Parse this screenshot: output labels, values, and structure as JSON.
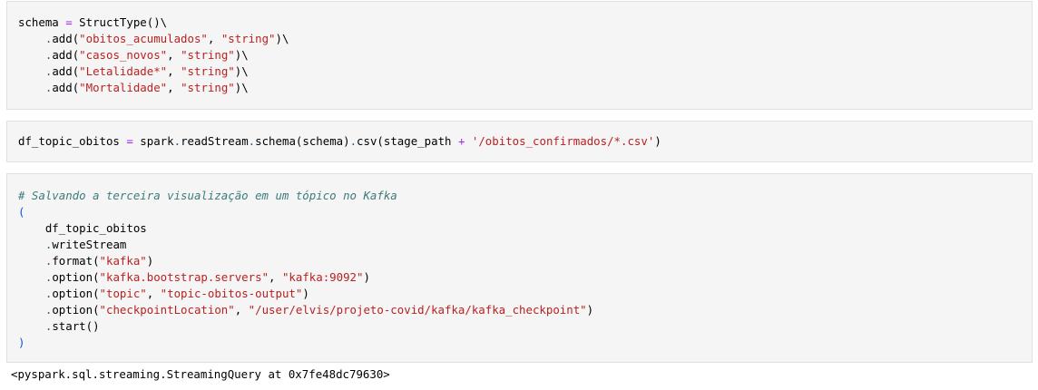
{
  "cells": [
    {
      "lines": [
        [
          {
            "t": "schema ",
            "c": ""
          },
          {
            "t": "=",
            "c": "op"
          },
          {
            "t": " StructType()\\",
            "c": ""
          }
        ],
        [
          {
            "t": "    ",
            "c": ""
          },
          {
            "t": ".",
            "c": "dot"
          },
          {
            "t": "add(",
            "c": ""
          },
          {
            "t": "\"obitos_acumulados\"",
            "c": "str"
          },
          {
            "t": ", ",
            "c": ""
          },
          {
            "t": "\"string\"",
            "c": "str"
          },
          {
            "t": ")\\",
            "c": ""
          }
        ],
        [
          {
            "t": "    ",
            "c": ""
          },
          {
            "t": ".",
            "c": "dot"
          },
          {
            "t": "add(",
            "c": ""
          },
          {
            "t": "\"casos_novos\"",
            "c": "str"
          },
          {
            "t": ", ",
            "c": ""
          },
          {
            "t": "\"string\"",
            "c": "str"
          },
          {
            "t": ")\\",
            "c": ""
          }
        ],
        [
          {
            "t": "    ",
            "c": ""
          },
          {
            "t": ".",
            "c": "dot"
          },
          {
            "t": "add(",
            "c": ""
          },
          {
            "t": "\"Letalidade*\"",
            "c": "str"
          },
          {
            "t": ", ",
            "c": ""
          },
          {
            "t": "\"string\"",
            "c": "str"
          },
          {
            "t": ")\\",
            "c": ""
          }
        ],
        [
          {
            "t": "    ",
            "c": ""
          },
          {
            "t": ".",
            "c": "dot"
          },
          {
            "t": "add(",
            "c": ""
          },
          {
            "t": "\"Mortalidade\"",
            "c": "str"
          },
          {
            "t": ", ",
            "c": ""
          },
          {
            "t": "\"string\"",
            "c": "str"
          },
          {
            "t": ")\\",
            "c": ""
          }
        ]
      ]
    },
    {
      "lines": [
        [
          {
            "t": "df_topic_obitos ",
            "c": ""
          },
          {
            "t": "=",
            "c": "op"
          },
          {
            "t": " spark",
            "c": ""
          },
          {
            "t": ".",
            "c": "dot"
          },
          {
            "t": "readStream",
            "c": ""
          },
          {
            "t": ".",
            "c": "dot"
          },
          {
            "t": "schema(schema)",
            "c": ""
          },
          {
            "t": ".",
            "c": "dot"
          },
          {
            "t": "csv(stage_path ",
            "c": ""
          },
          {
            "t": "+",
            "c": "op"
          },
          {
            "t": " ",
            "c": ""
          },
          {
            "t": "'/obitos_confirmados/*.csv'",
            "c": "str"
          },
          {
            "t": ")",
            "c": ""
          }
        ]
      ]
    },
    {
      "lines": [
        [
          {
            "t": "# Salvando a terceira visualização em um tópico no Kafka",
            "c": "cmt"
          }
        ],
        [
          {
            "t": "(",
            "c": "punc"
          }
        ],
        [
          {
            "t": "    df_topic_obitos",
            "c": ""
          }
        ],
        [
          {
            "t": "    ",
            "c": ""
          },
          {
            "t": ".",
            "c": "dot"
          },
          {
            "t": "writeStream",
            "c": ""
          }
        ],
        [
          {
            "t": "    ",
            "c": ""
          },
          {
            "t": ".",
            "c": "dot"
          },
          {
            "t": "format(",
            "c": ""
          },
          {
            "t": "\"kafka\"",
            "c": "str"
          },
          {
            "t": ")",
            "c": ""
          }
        ],
        [
          {
            "t": "    ",
            "c": ""
          },
          {
            "t": ".",
            "c": "dot"
          },
          {
            "t": "option(",
            "c": ""
          },
          {
            "t": "\"kafka.bootstrap.servers\"",
            "c": "str"
          },
          {
            "t": ", ",
            "c": ""
          },
          {
            "t": "\"kafka:9092\"",
            "c": "str"
          },
          {
            "t": ")",
            "c": ""
          }
        ],
        [
          {
            "t": "    ",
            "c": ""
          },
          {
            "t": ".",
            "c": "dot"
          },
          {
            "t": "option(",
            "c": ""
          },
          {
            "t": "\"topic\"",
            "c": "str"
          },
          {
            "t": ", ",
            "c": ""
          },
          {
            "t": "\"topic-obitos-output\"",
            "c": "str"
          },
          {
            "t": ")",
            "c": ""
          }
        ],
        [
          {
            "t": "    ",
            "c": ""
          },
          {
            "t": ".",
            "c": "dot"
          },
          {
            "t": "option(",
            "c": ""
          },
          {
            "t": "\"checkpointLocation\"",
            "c": "str"
          },
          {
            "t": ", ",
            "c": ""
          },
          {
            "t": "\"/user/elvis/projeto-covid/kafka/kafka_checkpoint\"",
            "c": "str"
          },
          {
            "t": ")",
            "c": ""
          }
        ],
        [
          {
            "t": "    ",
            "c": ""
          },
          {
            "t": ".",
            "c": "dot"
          },
          {
            "t": "start()",
            "c": ""
          }
        ],
        [
          {
            "t": ")",
            "c": "punc"
          }
        ]
      ]
    }
  ],
  "output": {
    "text": "<pyspark.sql.streaming.StreamingQuery at 0x7fe48dc79630>"
  }
}
